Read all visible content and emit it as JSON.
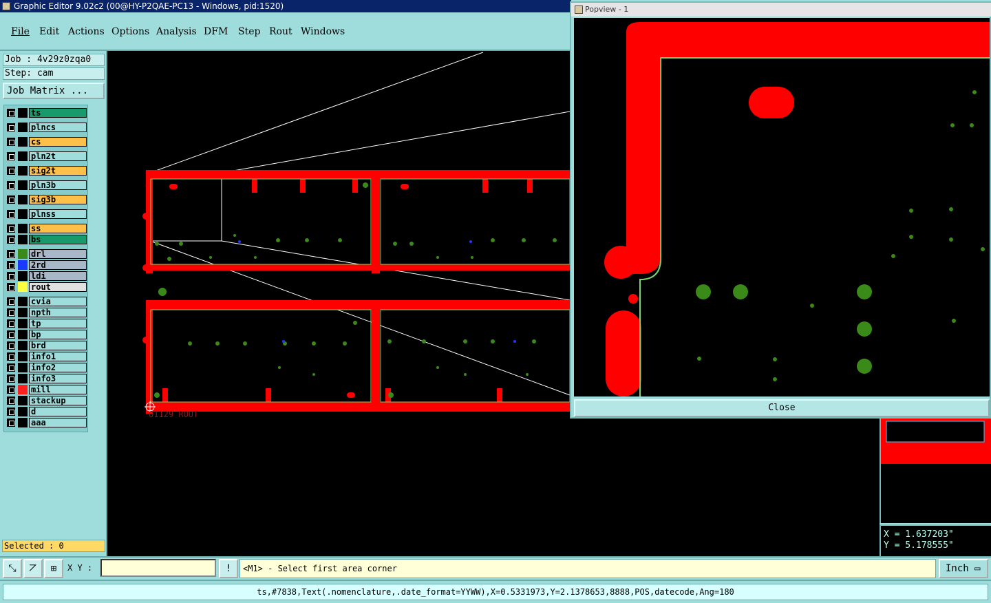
{
  "window": {
    "title": "Graphic Editor 9.02c2 (00@HY-P2QAE-PC13 - Windows, pid:1520)"
  },
  "menu": [
    "File",
    "Edit",
    "Actions",
    "Options",
    "Analysis",
    "DFM",
    "Step",
    "Rout",
    "Windows"
  ],
  "job": {
    "job_label": "Job : 4v29z0zqa0",
    "step_label": "Step: cam",
    "matrix_button": "Job Matrix ..."
  },
  "layers": [
    {
      "name": "ts",
      "color": "#1a9a6a"
    },
    {
      "name": "plncs",
      "color": "#9fdcdc"
    },
    {
      "name": "cs",
      "color": "#ffc04a"
    },
    {
      "name": "pln2t",
      "color": "#9fdcdc"
    },
    {
      "name": "sig2t",
      "color": "#ffc04a"
    },
    {
      "name": "pln3b",
      "color": "#9fdcdc"
    },
    {
      "name": "sig3b",
      "color": "#ffc04a"
    },
    {
      "name": "plnss",
      "color": "#9fdcdc"
    },
    {
      "name": "ss",
      "color": "#ffc04a"
    },
    {
      "name": "bs",
      "color": "#1a9a6a"
    },
    {
      "name": "drl",
      "color": "#a8b8c8",
      "swatch": "#3a8a1a"
    },
    {
      "name": "2rd",
      "color": "#a8b8c8",
      "swatch": "#1a3aff"
    },
    {
      "name": "ldi",
      "color": "#a8b8c8"
    },
    {
      "name": "rout",
      "color": "#e0e0e0",
      "swatch": "#ffff40"
    },
    {
      "name": "cvia",
      "color": "#9fdcdc"
    },
    {
      "name": "npth",
      "color": "#9fdcdc"
    },
    {
      "name": "tp",
      "color": "#9fdcdc"
    },
    {
      "name": "bp",
      "color": "#9fdcdc"
    },
    {
      "name": "brd",
      "color": "#9fdcdc"
    },
    {
      "name": "info1",
      "color": "#9fdcdc"
    },
    {
      "name": "info2",
      "color": "#9fdcdc"
    },
    {
      "name": "info3",
      "color": "#9fdcdc"
    },
    {
      "name": "mill",
      "color": "#9fdcdc",
      "swatch": "#ff2020"
    },
    {
      "name": "stackup",
      "color": "#9fdcdc"
    },
    {
      "name": "d",
      "color": "#9fdcdc"
    },
    {
      "name": "aaa",
      "color": "#9fdcdc"
    }
  ],
  "selected": "Selected : 0",
  "canvas": {
    "rout_label": "01129  ROUT"
  },
  "popview": {
    "title": "Popview - 1",
    "close_label": "Close"
  },
  "coords": {
    "x": "X  =  1.637203\"",
    "y": "Y  =  5.178555\""
  },
  "toolbar": {
    "xy_label": "X Y :",
    "xy_value": "",
    "bang": "!",
    "prompt": "<M1> - Select first area corner",
    "unit": "Inch"
  },
  "status": "ts,#7838,Text(.nomenclature,.date_format=YYWW),X=0.5331973,Y=2.1378653,8888,POS,datecode,Ang=180",
  "colors": {
    "copper": "#ff0000",
    "pad": "#3a8a1a",
    "via": "#1a3aff",
    "outline": "#7cd46c"
  }
}
